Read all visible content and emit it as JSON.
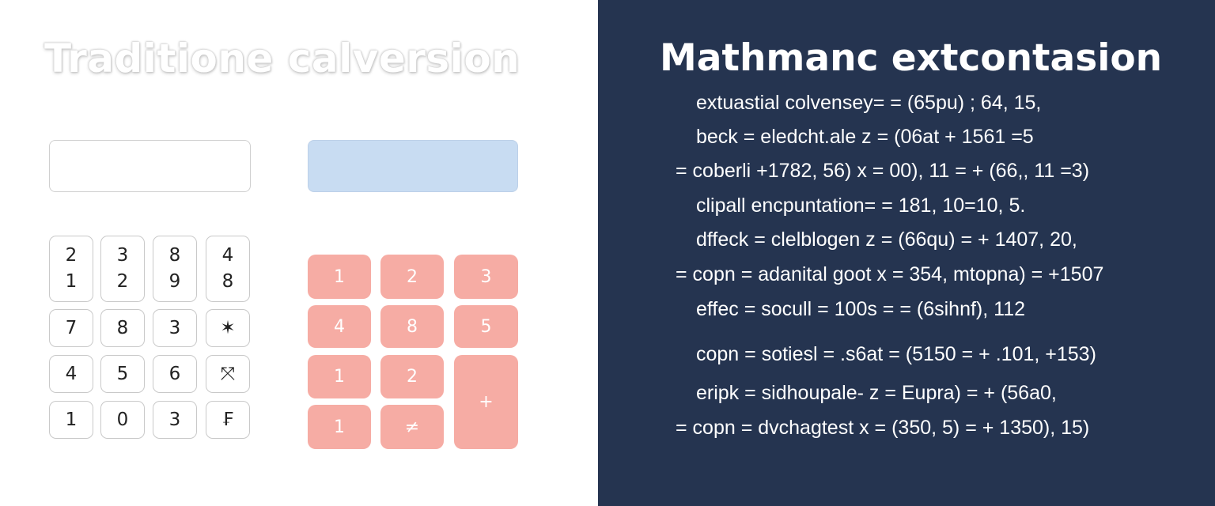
{
  "left": {
    "title": "Traditione calversion",
    "keypad_white": {
      "tall_row": [
        {
          "top": "2",
          "bottom": "1"
        },
        {
          "top": "3",
          "bottom": "2"
        },
        {
          "top": "8",
          "bottom": "9"
        },
        {
          "top": "4",
          "bottom": "8"
        }
      ],
      "rows": [
        [
          "7",
          "8",
          "3",
          "✶"
        ],
        [
          "4",
          "5",
          "6",
          "⤧"
        ],
        [
          "1",
          "0",
          "3",
          "₣"
        ]
      ]
    },
    "keypad_pink": {
      "keys": [
        "1",
        "2",
        "3",
        "4",
        "8",
        "5",
        "1",
        "2",
        "+",
        "1",
        "≠"
      ]
    }
  },
  "right": {
    "title": "Mathmanc extcontasion",
    "formulas": [
      "extuastial colvensey= = (65pu) ; 64, 15,",
      "beck = eledcht.ale  z  = (06at  + 1561 =5",
      "= coberli  +1782, 56) x = 00), 11 = + (66,, 11 =3)",
      "clipall encpuntation= = 181,  10=10,  5.",
      "dffeck = clelblogen z = (66qu) = + 1407,  20,",
      "= copn = adanital goot x = 354, mtopna) = +1507",
      "effec = socull = 100s = = (6sihnf),  112",
      "copn = sotiesl = .s6at  = (5150 = + .101, +153)",
      "eripk = sidhoupale- z  = Eupra) = + (56a0,",
      "= copn = dvchagtest x = (350,  5) = + 1350),  15)"
    ]
  },
  "colors": {
    "right_background": "#253450",
    "pink_key": "#f6aca4",
    "blue_display": "#c8dcf2"
  }
}
